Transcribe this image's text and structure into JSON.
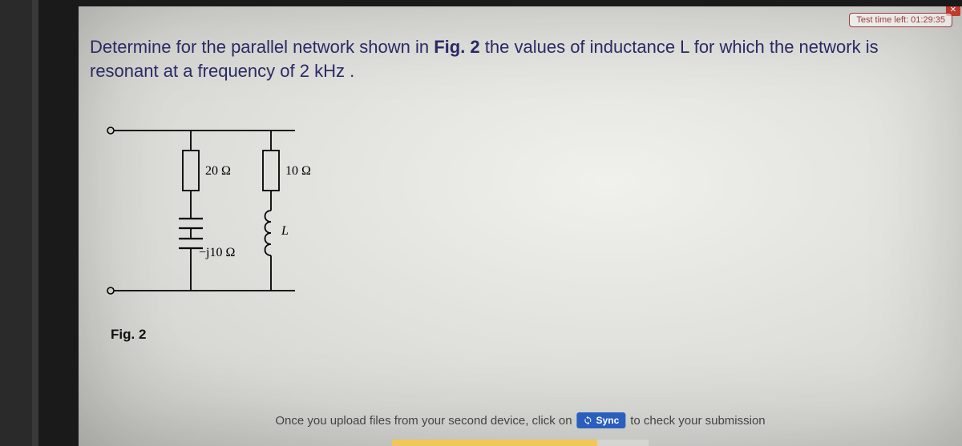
{
  "timer": {
    "label": "Test time left: 01:29:35"
  },
  "question": {
    "part1": "Determine for the parallel network shown in ",
    "figref": "Fig. 2",
    "part2": " the values of inductance L for which the network is resonant at a frequency of 2 kHz ."
  },
  "circuit": {
    "r1_label": "20 Ω",
    "r2_label": "10 Ω",
    "xc_label": "−j10 Ω",
    "l_label": "L"
  },
  "figure_caption": "Fig. 2",
  "upload": {
    "prefix": "Once you upload files from your second device, click on",
    "sync_label": "Sync",
    "suffix": "to check your submission"
  },
  "close_glyph": "✕"
}
